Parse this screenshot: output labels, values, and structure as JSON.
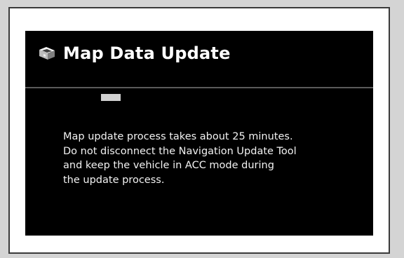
{
  "dialog": {
    "title": "Map Data Update",
    "title_icon": "map-update-icon",
    "message_lines": [
      "Map update process takes about 25 minutes.",
      "Do not disconnect the Navigation Update Tool",
      "and keep the vehicle in ACC mode during",
      "the update process."
    ]
  },
  "colors": {
    "screen_background": "#000000",
    "text": "#ffffff",
    "progress_fill": "#d0d0d0"
  }
}
